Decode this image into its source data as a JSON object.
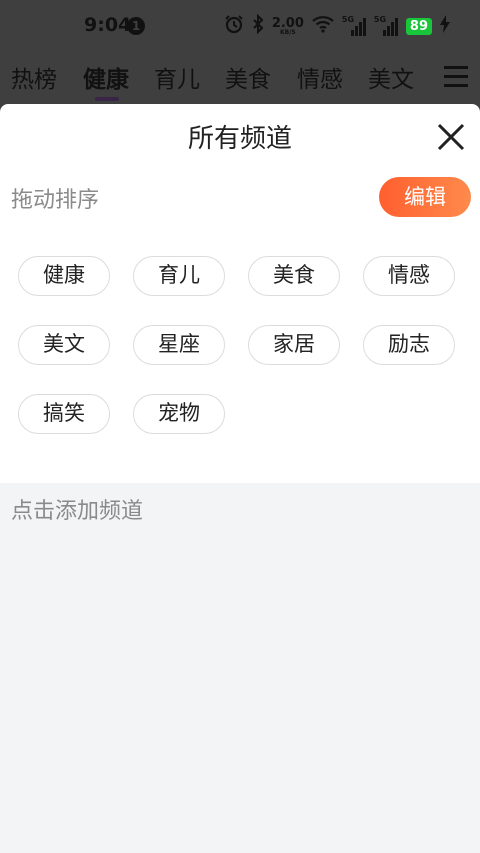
{
  "status_bar": {
    "time": "9:04",
    "notification_count": "1",
    "net_speed_value": "2.00",
    "net_speed_unit": "KB/S",
    "signal_1": "5G",
    "signal_2": "5G",
    "battery": "89"
  },
  "channel_tabs": [
    "热榜",
    "健康",
    "育儿",
    "美食",
    "情感",
    "美文"
  ],
  "active_tab": "健康",
  "sheet": {
    "title": "所有频道",
    "sort_hint": "拖动排序",
    "edit_label": "编辑",
    "my_channels": [
      "健康",
      "育儿",
      "美食",
      "情感",
      "美文",
      "星座",
      "家居",
      "励志",
      "搞笑",
      "宠物"
    ],
    "add_hint": "点击添加频道"
  },
  "colors": {
    "accent": "#ff6a35",
    "chip_border": "#dcdcdc",
    "overlay": "#3f3f3f",
    "battery": "#19c53b"
  }
}
